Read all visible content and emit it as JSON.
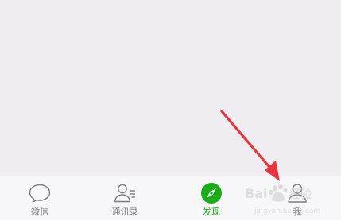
{
  "tab_bar": {
    "active_color": "#1aad19",
    "inactive_color": "#7c7b80",
    "tabs": [
      {
        "label": "微信",
        "icon": "chat-bubble-icon",
        "active": false
      },
      {
        "label": "通讯录",
        "icon": "contacts-icon",
        "active": false
      },
      {
        "label": "发现",
        "icon": "compass-icon",
        "active": true
      },
      {
        "label": "我",
        "icon": "person-icon",
        "active": false
      }
    ]
  },
  "annotation": {
    "arrow_color": "#e8343a",
    "target": "tab-me"
  },
  "watermark": {
    "icon": "baidu-paw-icon",
    "text": "Bai 经验",
    "url_text": "jingyan.baidu.com"
  }
}
